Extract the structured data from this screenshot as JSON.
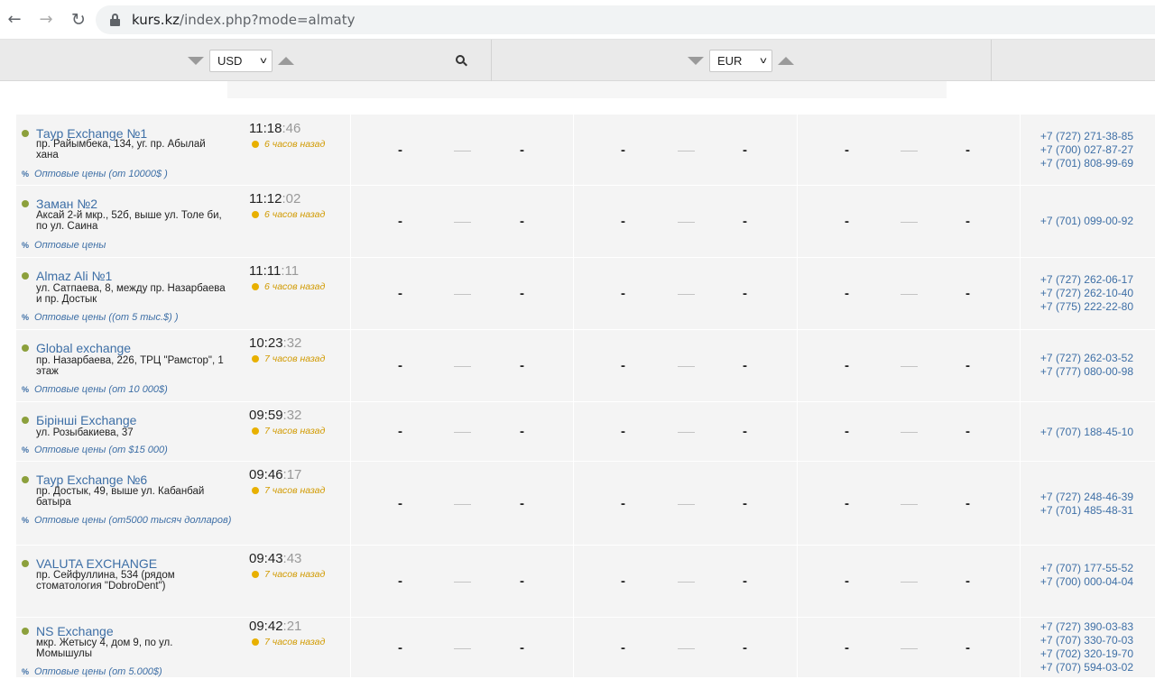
{
  "browser": {
    "url_host": "kurs.kz",
    "url_path": "/index.php?mode=almaty"
  },
  "currency_header": {
    "left_currency": "USD",
    "right_currency": "EUR"
  },
  "rate_placeholder": "-",
  "exchanges": [
    {
      "name": "Тауp Exchange №1",
      "address": "пр. Райымбека, 134, уг. пр. Абылай хана",
      "wholesale": "Оптовые цены (от 10000$ )",
      "time_hm": "11:18",
      "time_s": ":46",
      "ago": "6 часов назад",
      "phones": [
        "+7 (727) 271-38-85",
        "+7 (700) 027-87-27",
        "+7 (701) 808-99-69"
      ]
    },
    {
      "name": "Заман №2",
      "address": "Аксай 2-й мкр., 52б, выше ул. Толе би, по ул. Саина",
      "wholesale": "Оптовые цены",
      "time_hm": "11:12",
      "time_s": ":02",
      "ago": "6 часов назад",
      "phones": [
        "+7 (701) 099-00-92"
      ]
    },
    {
      "name": "Almaz Ali №1",
      "address": "ул. Сатпаева, 8, между пр. Назарбаева и пр. Достык",
      "wholesale": "Оптовые цены ((от 5 тыс.$) )",
      "time_hm": "11:11",
      "time_s": ":11",
      "ago": "6 часов назад",
      "phones": [
        "+7 (727) 262-06-17",
        "+7 (727) 262-10-40",
        "+7 (775) 222-22-80"
      ]
    },
    {
      "name": "Global exchange",
      "address": "пр. Назарбаева, 226, ТРЦ \"Рамстор\", 1 этаж",
      "wholesale": "Оптовые цены (от 10 000$)",
      "time_hm": "10:23",
      "time_s": ":32",
      "ago": "7 часов назад",
      "phones": [
        "+7 (727) 262-03-52",
        "+7 (777) 080-00-98"
      ]
    },
    {
      "name": "Бірінші Exchange",
      "address": "ул. Розыбакиева, 37",
      "wholesale": "Оптовые цены (от $15 000)",
      "time_hm": "09:59",
      "time_s": ":32",
      "ago": "7 часов назад",
      "phones": [
        "+7 (707) 188-45-10"
      ]
    },
    {
      "name": "Тауp Exchange №6",
      "address": "пр. Достык, 49, выше ул. Кабанбай батыра",
      "wholesale": "Оптовые цены (от5000 тысяч долларов)",
      "time_hm": "09:46",
      "time_s": ":17",
      "ago": "7 часов назад",
      "phones": [
        "+7 (727) 248-46-39",
        "+7 (701) 485-48-31"
      ]
    },
    {
      "name": "VALUTA EXCHANGE",
      "address": "пр. Сейфуллина, 534 (рядом стоматология \"DobroDent\")",
      "wholesale": "",
      "time_hm": "09:43",
      "time_s": ":43",
      "ago": "7 часов назад",
      "phones": [
        "+7 (707) 177-55-52",
        "+7 (700) 000-04-04"
      ]
    },
    {
      "name": "NS Exchange",
      "address": "мкр. Жетысу 4, дом 9, по ул. Момышулы",
      "wholesale": "Оптовые цены (от 5.000$)",
      "time_hm": "09:42",
      "time_s": ":21",
      "ago": "7 часов назад",
      "phones": [
        "+7 (727) 390-03-83",
        "+7 (707) 330-70-03",
        "+7 (702) 320-19-70",
        "+7 (707) 594-03-02"
      ]
    }
  ]
}
